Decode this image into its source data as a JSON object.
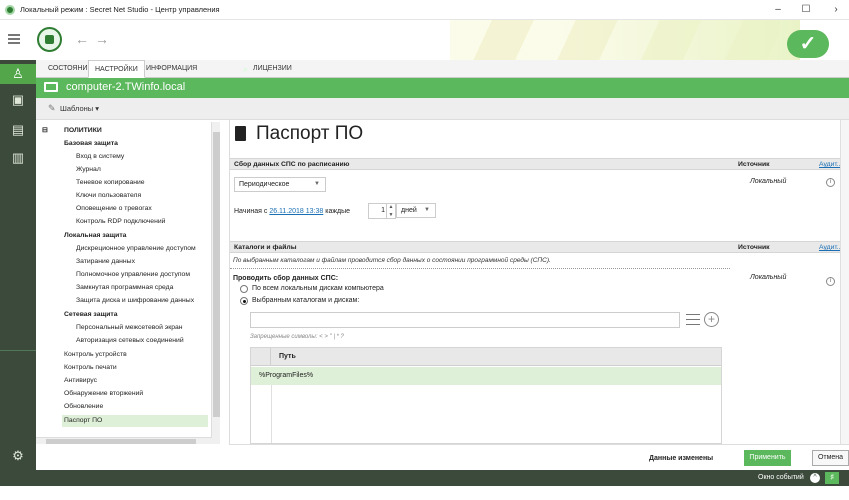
{
  "window": {
    "title": "Локальный режим : Secret Net Studio - Центр управления",
    "minimize": "–",
    "maximize": "☐",
    "close": "›"
  },
  "tabs": [
    {
      "label": "СОСТОЯНИЕ"
    },
    {
      "label": "НАСТРОЙКИ"
    },
    {
      "label": "ИНФОРМАЦИЯ"
    },
    {
      "label": "ЛИЦЕНЗИИ"
    }
  ],
  "computer_name": "computer-2.TWinfo.local",
  "templates_label": "Шаблоны",
  "tree": {
    "root": "ПОЛИТИКИ",
    "groups": [
      {
        "label": "Базовая защита",
        "items": [
          "Вход в систему",
          "Журнал",
          "Теневое копирование",
          "Ключи пользователя",
          "Оповещение о тревогах",
          "Контроль RDP подключений"
        ]
      },
      {
        "label": "Локальная защита",
        "items": [
          "Дискреционное управление доступом",
          "Затирание данных",
          "Полномочное управление доступом",
          "Замкнутая программная среда",
          "Защита диска и шифрование данных"
        ]
      },
      {
        "label": "Сетевая защита",
        "items": [
          "Персональный межсетевой экран",
          "Авторизация сетевых соединений"
        ]
      }
    ],
    "top_items": [
      "Контроль устройств",
      "Контроль печати",
      "Антивирус",
      "Обнаружение вторжений",
      "Обновление",
      "Паспорт ПО"
    ]
  },
  "page": {
    "title": "Паспорт ПО",
    "section1": {
      "header": "Сбор данных СПС по расписанию",
      "source_header": "Источник",
      "audit_link": "Аудит...",
      "mode": "Периодическое",
      "source_value": "Локальный",
      "starting_prefix": "Начиная с",
      "start_date": "26.11.2018 13:38",
      "every_label": "каждые",
      "interval": "1",
      "unit": "дней"
    },
    "section2": {
      "header": "Каталоги и файлы",
      "source_header": "Источник",
      "audit_link": "Аудит...",
      "description": "По выбранным каталогам и файлам проводится сбор данных о состоянии программной среды (СПС).",
      "collect_label": "Проводить сбор данных СПС:",
      "option_all": "По всем локальным дискам компьютера",
      "option_selected": "Выбранным каталогам и дискам:",
      "source_value": "Локальный",
      "path_placeholder": "",
      "forbidden_chars": "Запрещенные символы: < > \" | * ?",
      "table_header": "Путь",
      "rows": [
        "%ProgramFiles%"
      ]
    }
  },
  "footer": {
    "status": "Данные изменены",
    "apply": "Применить",
    "cancel": "Отмена",
    "events_window": "Окно событий"
  },
  "colors": {
    "accent": "#5cb85c",
    "rail": "#3c4a3b"
  }
}
